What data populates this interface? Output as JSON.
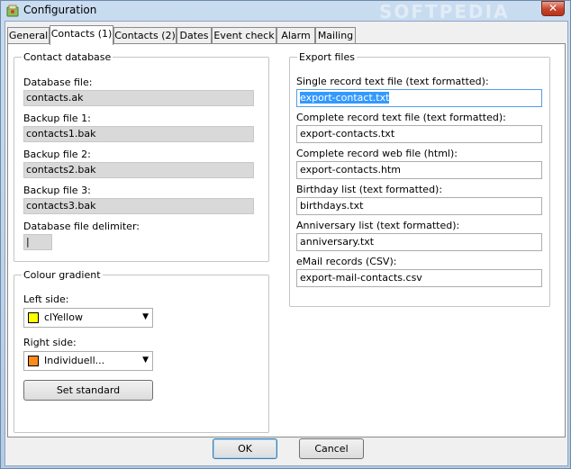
{
  "window": {
    "title": "Configuration",
    "watermark": "SOFTPEDIA",
    "close_glyph": "✕"
  },
  "tabs": [
    {
      "label": "General"
    },
    {
      "label": "Contacts (1)"
    },
    {
      "label": "Contacts (2)"
    },
    {
      "label": "Dates"
    },
    {
      "label": "Event check"
    },
    {
      "label": "Alarm"
    },
    {
      "label": "Mailing"
    }
  ],
  "contact_database": {
    "title": "Contact database",
    "database_file_label": "Database file:",
    "database_file": "contacts.ak",
    "backup1_label": "Backup file 1:",
    "backup1": "contacts1.bak",
    "backup2_label": "Backup file 2:",
    "backup2": "contacts2.bak",
    "backup3_label": "Backup file 3:",
    "backup3": "contacts3.bak",
    "delimiter_label": "Database file delimiter:",
    "delimiter": "|"
  },
  "colour_gradient": {
    "title": "Colour gradient",
    "left_label": "Left side:",
    "left_value": "clYellow",
    "left_color": "#ffff00",
    "right_label": "Right side:",
    "right_value": "Individuell...",
    "right_color": "#ff8a1c",
    "set_standard": "Set standard"
  },
  "export_files": {
    "title": "Export files",
    "single_label": "Single record text file (text formatted):",
    "single_value": "export-contact.txt",
    "complete_text_label": "Complete record text file (text formatted):",
    "complete_text_value": "export-contacts.txt",
    "complete_web_label": "Complete record web file (html):",
    "complete_web_value": "export-contacts.htm",
    "birthday_label": "Birthday list (text formatted):",
    "birthday_value": "birthdays.txt",
    "anniversary_label": "Anniversary list (text formatted):",
    "anniversary_value": "anniversary.txt",
    "email_label": "eMail records (CSV):",
    "email_value": "export-mail-contacts.csv"
  },
  "buttons": {
    "ok": "OK",
    "cancel": "Cancel"
  }
}
